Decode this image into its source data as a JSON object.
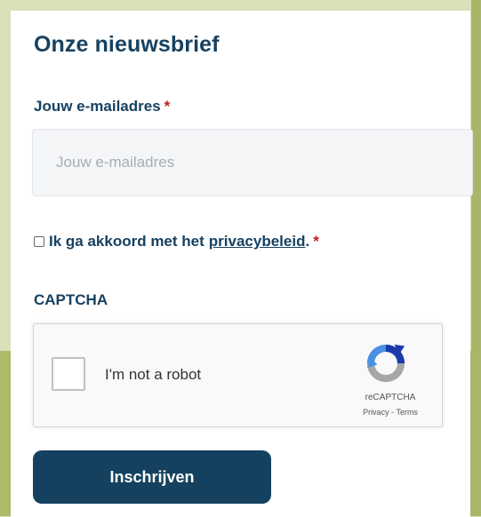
{
  "newsletter": {
    "title": "Onze nieuwsbrief",
    "email_label": "Jouw e-mailadres",
    "required_marker": "*",
    "email_placeholder": "Jouw e-mailadres",
    "email_value": "",
    "consent": {
      "text_before": "Ik ga akkoord met het",
      "link_text": "privacybeleid",
      "text_after": ".",
      "required_marker": "*",
      "checked": false
    },
    "captcha_label": "CAPTCHA",
    "recaptcha": {
      "checkbox_text": "I'm not a robot",
      "brand": "reCAPTCHA",
      "privacy_link": "Privacy",
      "separator": "-",
      "terms_link": "Terms"
    },
    "submit_label": "Inschrijven"
  },
  "colors": {
    "brand_dark_blue": "#14415f",
    "required_red": "#c0191c",
    "background_light_green": "#d9e1b8",
    "background_olive": "#aeb96a"
  },
  "icons": {
    "recaptcha_logo": "recaptcha-logo-icon"
  }
}
